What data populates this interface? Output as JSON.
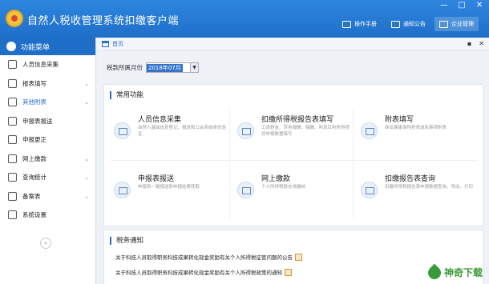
{
  "app": {
    "title": "自然人税收管理系统扣缴客户端"
  },
  "window_controls": [
    "—",
    "□",
    "✕"
  ],
  "toolbar": [
    {
      "label": "操作手册",
      "icon": "book-icon"
    },
    {
      "label": "通知公告",
      "icon": "mail-icon"
    },
    {
      "label": "企业管理",
      "icon": "building-icon"
    }
  ],
  "sidebar": {
    "header": "功能菜单",
    "items": [
      {
        "label": "人员信息采集",
        "icon": "person-icon",
        "has_chevron": false
      },
      {
        "label": "报表填写",
        "icon": "edit-icon",
        "has_chevron": true
      },
      {
        "label": "其他附表",
        "icon": "grid-icon",
        "has_chevron": true
      },
      {
        "label": "申报表报送",
        "icon": "send-icon",
        "has_chevron": false
      },
      {
        "label": "申报更正",
        "icon": "search-icon",
        "has_chevron": false
      },
      {
        "label": "网上缴款",
        "icon": "folder-icon",
        "has_chevron": true
      },
      {
        "label": "查询统计",
        "icon": "query-icon",
        "has_chevron": true
      },
      {
        "label": "备案表",
        "icon": "file-icon",
        "has_chevron": true
      },
      {
        "label": "系统设置",
        "icon": "gear-icon",
        "has_chevron": false
      }
    ],
    "collapse_glyph": "«"
  },
  "breadcrumb": {
    "label": "首页",
    "controls": [
      "▪",
      "✕"
    ]
  },
  "period": {
    "label": "税款所属月份",
    "value": "2018年07月",
    "arrow": "▼"
  },
  "common_functions": {
    "title": "常用功能",
    "items": [
      {
        "title": "人员信息采集",
        "desc": "自然人基础信息登记、报送和公会系统身份验证"
      },
      {
        "title": "扣缴所得税报告表填写",
        "desc": "工资薪金、劳务报酬、稿酬、利息红利所得项目申报数据填写"
      },
      {
        "title": "附表填写",
        "desc": "商业健康保险附表减免事项附表"
      },
      {
        "title": "申报表报送",
        "desc": "申报表一键报送和申报结果获取"
      },
      {
        "title": "网上缴款",
        "desc": "个人所得税款在线缴纳"
      },
      {
        "title": "扣缴报告表查询",
        "desc": "扣缴所得税报告表申报数据查询、导出、打印"
      }
    ]
  },
  "tax_notices": {
    "title": "税务通知",
    "items": [
      "关于科技人员取得职务科技成果转化现金奖励有关个人所得税征管问题的公告",
      "关于科技人员取得职务科技成果转化现金奖励有关个人所得税政策的通知"
    ]
  },
  "watermark": {
    "text": "神奇下载"
  }
}
